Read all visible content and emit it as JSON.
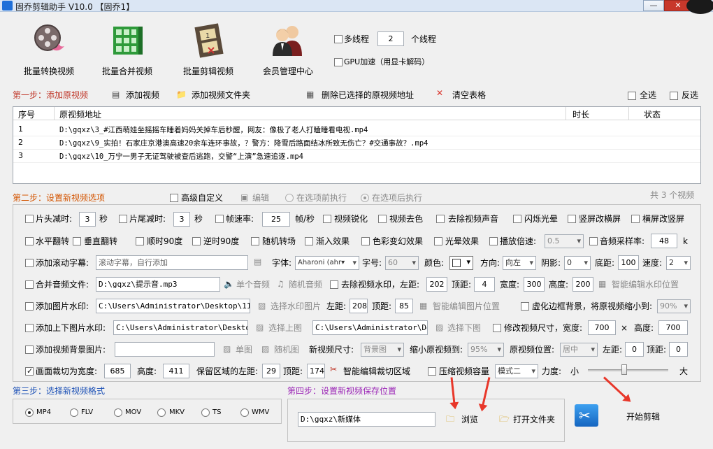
{
  "window": {
    "title": "固乔剪辑助手 V10.0  【固乔1】",
    "minimize": "—",
    "close": "✕"
  },
  "toolbar": {
    "batch_convert": "批量转换视频",
    "batch_merge": "批量合并视频",
    "batch_cut": "批量剪辑视频",
    "member_center": "会员管理中心",
    "multithread_label": "多线程",
    "thread_count": "2",
    "thread_unit": "个线程",
    "gpu_label": "GPU加速（用显卡解码）"
  },
  "step1": {
    "title": "第一步：添加原视频",
    "add_video": "添加视频",
    "add_folder": "添加视频文件夹",
    "delete_selected": "删除已选择的原视频地址",
    "clear_table": "清空表格",
    "select_all": "全选",
    "invert": "反选"
  },
  "table": {
    "columns": [
      "序号",
      "原视频地址",
      "时长",
      "状态"
    ],
    "rows": [
      {
        "no": "1",
        "path": "D:\\gqxz\\3_#江西萌娃坐摇摇车睡着妈妈关掉车后秒醒，网友：像极了老人打瞌睡看电视.mp4"
      },
      {
        "no": "2",
        "path": "D:\\gqxz\\9_实拍！石家庄京港澳高速20余车连环事故，？警方：降雪后路面结冰所致无伤亡？#交通事故？.mp4"
      },
      {
        "no": "3",
        "path": "D:\\gqxz\\10_万宁一男子无证驾驶被查后逃跑，交警“上演”急速追逐.mp4"
      }
    ],
    "total": "共 3 个视频"
  },
  "step2": {
    "title": "第二步：设置新视频选项",
    "advanced_custom": "高级自定义",
    "edit": "编辑",
    "before_opt": "在选项前执行",
    "after_opt": "在选项后执行",
    "row1": {
      "head_cut": "片头减时:",
      "head_val": "3",
      "sec1": "秒",
      "tail_cut": "片尾减时:",
      "tail_val": "3",
      "sec2": "秒",
      "fps_reduce": "帧速率:",
      "fps_val": "25",
      "fps_unit": "帧/秒",
      "sharpen": "视频锐化",
      "decolor": "视频去色",
      "remove_audio": "去除视频声音",
      "flash": "闪烁光晕",
      "v2h": "竖屏改横屏",
      "h2v": "横屏改竖屏"
    },
    "row2": {
      "hflip": "水平翻转",
      "vflip": "垂直翻转",
      "rot90cw": "顺时90度",
      "rot90ccw": "逆时90度",
      "random_trans": "随机转场",
      "fade_in": "渐入效果",
      "color_effect": "色彩变幻效果",
      "glow": "光晕效果",
      "speed": "播放倍速:",
      "speed_val": "0.5",
      "sample_rate": "音频采样率:",
      "sample_val": "48",
      "k": "k"
    },
    "row3": {
      "scroll_sub": "添加滚动字幕:",
      "scroll_placeholder": "滚动字幕，自行添加",
      "font": "字体:",
      "font_val": "Aharoni (ahr▾",
      "size": "字号:",
      "size_val": "60",
      "color": "颜色:",
      "direction": "方向:",
      "dir_val": "向左",
      "shadow": "阴影:",
      "shadow_val": "0",
      "bottom": "底距:",
      "bottom_val": "100",
      "speed": "速度:",
      "speed_val": "2"
    },
    "row4": {
      "merge_audio": "合并音频文件:",
      "audio_path": "D:\\gqxz\\提示音.mp3",
      "single_audio": "单个音频",
      "random_audio": "随机音频",
      "remove_wm": "去除视频水印，左距:",
      "wm_left": "202",
      "top": "顶距:",
      "wm_top": "4",
      "width": "宽度:",
      "wm_w": "300",
      "height": "高度:",
      "wm_h": "200",
      "smart_wm": "智能编辑水印位置"
    },
    "row5": {
      "img_wm": "添加图片水印:",
      "img_path": "C:\\Users\\Administrator\\Desktop\\111.j",
      "choose_wm": "选择水印图片",
      "left": "左距:",
      "left_val": "208",
      "top": "顶距:",
      "top_val": "85",
      "smart_img": "智能编辑图片位置",
      "blur_bg": "虚化边框背景，将原视频缩小到:",
      "blur_val": "90%"
    },
    "row6": {
      "tb_wm": "添加上下图片水印:",
      "top_path": "C:\\Users\\Administrator\\Desktop\\i",
      "choose_top": "选择上图",
      "bot_path": "C:\\Users\\Administrator\\Desk",
      "choose_bot": "选择下图",
      "resize": "修改视频尺寸，宽度:",
      "resize_w": "700",
      "x": "×",
      "height": "高度:",
      "resize_h": "700"
    },
    "row7": {
      "bg_img": "添加视频背景图片:",
      "single_img": "单图",
      "random_img": "随机图",
      "new_size": "新视频尺寸:",
      "new_size_val": "背景图",
      "shrink": "缩小原视频到:",
      "shrink_val": "95%",
      "pos": "原视频位置:",
      "pos_val": "居中",
      "left": "左距:",
      "left_val": "0",
      "top": "顶距:",
      "top_val": "0"
    },
    "row8": {
      "crop": "画面裁切为宽度:",
      "crop_w": "685",
      "height": "高度:",
      "crop_h": "411",
      "keep_left": "保留区域的左距:",
      "keep_left_val": "29",
      "top": "顶距:",
      "keep_top_val": "174",
      "smart_crop": "智能编辑裁切区域",
      "compress": "压缩视频容量",
      "mode": "模式二",
      "strength": "力度:",
      "small": "小",
      "large": "大",
      "strength_level": 0.45
    }
  },
  "step3": {
    "title": "第三步：选择新视频格式",
    "formats": [
      "MP4",
      "FLV",
      "MOV",
      "MKV",
      "TS",
      "WMV"
    ],
    "selected": "MP4"
  },
  "step4": {
    "title": "第四步：设置新视频保存位置",
    "save_path": "D:\\gqxz\\新媒体",
    "browse": "浏览",
    "open_folder": "打开文件夹"
  },
  "start": {
    "label": "开始剪辑"
  },
  "colors": {
    "step_red": "#c0392b",
    "step_blue": "#1a4fb5",
    "step_purple": "#9b26b6",
    "arrow": "#e8372a"
  }
}
